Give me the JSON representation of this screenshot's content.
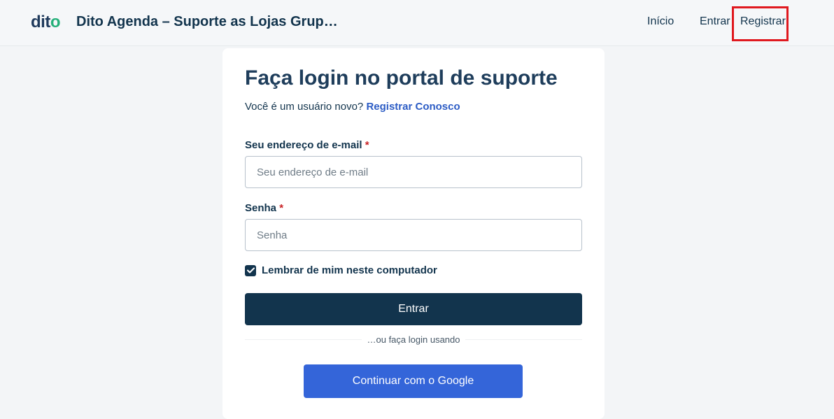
{
  "header": {
    "logo_text": "dit",
    "logo_dot": "o",
    "site_title": "Dito Agenda – Suporte as Lojas Grup…",
    "nav": {
      "home": "Início",
      "login": "Entrar",
      "register": "Registrar"
    }
  },
  "login": {
    "title": "Faça login no portal de suporte",
    "new_user_text": "Você é um usuário novo?",
    "register_link": "Registrar Conosco",
    "email": {
      "label": "Seu endereço de e-mail",
      "required_mark": "*",
      "placeholder": "Seu endereço de e-mail",
      "value": ""
    },
    "password": {
      "label": "Senha",
      "required_mark": "*",
      "placeholder": "Senha",
      "value": ""
    },
    "remember": {
      "label": "Lembrar de mim neste computador",
      "checked": true
    },
    "submit_label": "Entrar",
    "or_text": "…ou faça login usando",
    "google_label": "Continuar com o Google"
  },
  "colors": {
    "primary": "#12344d",
    "link": "#2c5cc5",
    "google_button": "#3465d9",
    "required": "#c82124",
    "highlight_box": "#e0191f"
  }
}
